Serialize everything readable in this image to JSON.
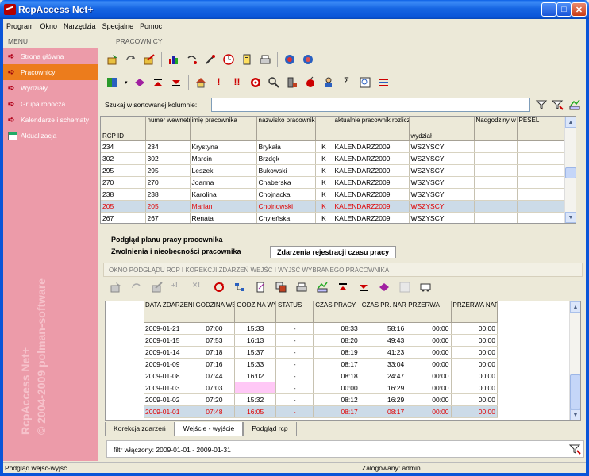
{
  "window": {
    "title": "RcpAccess Net+"
  },
  "menu": [
    "Program",
    "Okno",
    "Narzędzia",
    "Specjalne",
    "Pomoc"
  ],
  "sidebar": {
    "header": "MENU",
    "items": [
      {
        "label": "Strona główna"
      },
      {
        "label": "Pracownicy"
      },
      {
        "label": "Wydziały"
      },
      {
        "label": "Grupa robocza"
      },
      {
        "label": "Kalendarze i schematy"
      },
      {
        "label": "Aktualizacja"
      }
    ],
    "watermark_line1": "RcpAccess Net+",
    "watermark_line2": "© 2004-2009 polman-software"
  },
  "main": {
    "section_title": "PRACOWNICY"
  },
  "search": {
    "label": "Szukaj w sortowanej kolumnie:",
    "value": ""
  },
  "employees": {
    "columns": [
      "RCP ID",
      "numer wewnetrzny",
      "imię pracownika",
      "nazwisko pracownika",
      "",
      "aktualnie pracownik rozliczany według:",
      "wydział",
      "Nadgodziny w okr. rozl.",
      "PESEL"
    ],
    "rows": [
      [
        "234",
        "234",
        "Krystyna",
        "Brykała",
        "K",
        "KALENDARZ2009",
        "WSZYSCY",
        "",
        ""
      ],
      [
        "302",
        "302",
        "Marcin",
        "Brzdęk",
        "K",
        "KALENDARZ2009",
        "WSZYSCY",
        "",
        ""
      ],
      [
        "295",
        "295",
        "Leszek",
        "Bukowski",
        "K",
        "KALENDARZ2009",
        "WSZYSCY",
        "",
        ""
      ],
      [
        "270",
        "270",
        "Joanna",
        "Chaberska",
        "K",
        "KALENDARZ2009",
        "WSZYSCY",
        "",
        ""
      ],
      [
        "238",
        "238",
        "Karolina",
        "Chojnacka",
        "K",
        "KALENDARZ2009",
        "WSZYSCY",
        "",
        ""
      ],
      [
        "205",
        "205",
        "Marian",
        "Chojnowski",
        "K",
        "KALENDARZ2009",
        "WSZYSCY",
        "",
        ""
      ],
      [
        "267",
        "267",
        "Renata",
        "Chyleńska",
        "K",
        "KALENDARZ2009",
        "WSZYSCY",
        "",
        ""
      ]
    ],
    "selected_index": 5
  },
  "tabs": {
    "tab1": "Podgląd planu pracy pracownika",
    "tab2": "Zwolnienia i nieobecności pracownika",
    "tab3": "Zdarzenia rejestracji czasu pracy"
  },
  "okno_label": "OKNO PODGLĄDU RCP I  KOREKCJI ZDARZEŃ WEJŚĆ I WYJŚĆ WYBRANEGO PRACOWNIKA",
  "events": {
    "columns": [
      "DATA ZDARZENIA",
      "GODZINA WEJŚCIA",
      "GODZINA WYJŚCIA",
      "STATUS",
      "CZAS PRACY",
      "CZAS PR. NARASTAJ.",
      "PRZERWA",
      "PRZERWA NARASTAJ."
    ],
    "rows": [
      [
        "2009-01-21",
        "07:00",
        "15:33",
        "-",
        "08:33",
        "58:16",
        "00:00",
        "00:00"
      ],
      [
        "2009-01-15",
        "07:53",
        "16:13",
        "-",
        "08:20",
        "49:43",
        "00:00",
        "00:00"
      ],
      [
        "2009-01-14",
        "07:18",
        "15:37",
        "-",
        "08:19",
        "41:23",
        "00:00",
        "00:00"
      ],
      [
        "2009-01-09",
        "07:16",
        "15:33",
        "-",
        "08:17",
        "33:04",
        "00:00",
        "00:00"
      ],
      [
        "2009-01-08",
        "07:44",
        "16:02",
        "-",
        "08:18",
        "24:47",
        "00:00",
        "00:00"
      ],
      [
        "2009-01-03",
        "07:03",
        "",
        "-",
        "00:00",
        "16:29",
        "00:00",
        "00:00"
      ],
      [
        "2009-01-02",
        "07:20",
        "15:32",
        "-",
        "08:12",
        "16:29",
        "00:00",
        "00:00"
      ],
      [
        "2009-01-01",
        "07:48",
        "16:05",
        "-",
        "08:17",
        "08:17",
        "00:00",
        "00:00"
      ]
    ],
    "selected_index": 7,
    "highlight_empty_row": 5
  },
  "bottom_tabs": [
    "Korekcja zdarzeń",
    "Wejście - wyjście",
    "Podgląd rcp"
  ],
  "filter_text": "filtr włączony: 2009-01-01 - 2009-01-31",
  "status": {
    "left": "Podgląd wejść-wyjść",
    "user": "Zalogowany: admin"
  },
  "colors": {
    "sidebar": "#ec9ba9",
    "active_item": "#ec7c1c",
    "selected_text": "#e00000",
    "selected_bg": "#ccdbe8"
  },
  "icons": {
    "toolbar1": [
      "add-record-icon",
      "refresh-icon",
      "edit-icon",
      "chart-icon",
      "undo-icon",
      "tools-icon",
      "clock-icon",
      "document-icon",
      "print-icon",
      "globe-icon",
      "globe-icon"
    ],
    "toolbar2": [
      "grid-icon",
      "book-icon",
      "up-icon",
      "down-icon",
      "home-icon",
      "exclamation-icon",
      "double-exclamation-icon",
      "target-icon",
      "search-icon",
      "building-icon",
      "bomb-icon",
      "user-icon",
      "sigma-icon",
      "find-icon",
      "settings-icon"
    ]
  }
}
